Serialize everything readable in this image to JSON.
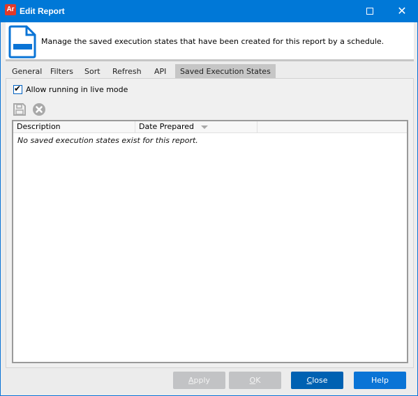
{
  "window": {
    "app_icon_text": "Ar",
    "title": "Edit Report",
    "maximize_icon": "maximize-icon",
    "close_icon": "close-icon",
    "close_glyph": "✕"
  },
  "header": {
    "icon": "report-document-icon",
    "description": "Manage the saved execution states that have been created for this report by a schedule."
  },
  "tabs": [
    {
      "label": "General",
      "active": false
    },
    {
      "label": "Filters",
      "active": false
    },
    {
      "label": "Sort",
      "active": false
    },
    {
      "label": "Refresh",
      "active": false
    },
    {
      "label": "API",
      "active": false
    },
    {
      "label": "Saved Execution States",
      "active": true
    }
  ],
  "live_mode": {
    "label": "Allow running in live mode",
    "checked": true,
    "check_glyph": "✔"
  },
  "toolbar": {
    "save_icon": "save-icon",
    "delete_icon": "delete-icon"
  },
  "grid": {
    "columns": [
      {
        "label": "Description"
      },
      {
        "label": "Date Prepared",
        "sorted": "descending"
      }
    ],
    "rows": [],
    "empty_message": "No saved execution states exist for this report."
  },
  "buttons": {
    "apply": {
      "mnemonic": "A",
      "rest": "pply",
      "enabled": false
    },
    "ok": {
      "mnemonic": "O",
      "rest": "K",
      "enabled": false
    },
    "close": {
      "mnemonic": "C",
      "rest": "lose",
      "enabled": true
    },
    "help": {
      "label": "Help",
      "enabled": true
    }
  },
  "colors": {
    "title_bar": "#0078d7",
    "accent": "#0a74d6",
    "close_button": "#0061b2",
    "disabled_button": "#c2c3c5"
  }
}
